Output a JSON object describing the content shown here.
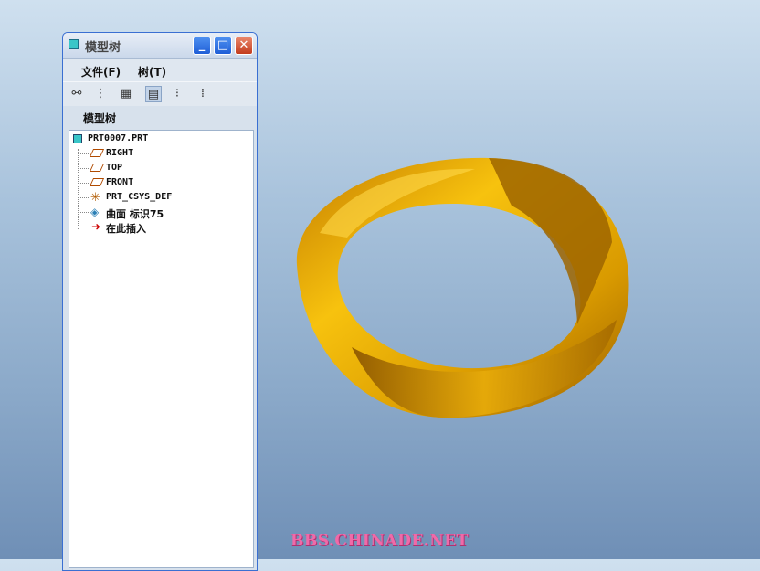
{
  "window": {
    "title": "模型树",
    "minimize": "_",
    "maximize": "□",
    "close": "✕"
  },
  "menu": {
    "file": "文件(F)",
    "tree": "树(T)"
  },
  "panel": {
    "label": "模型树"
  },
  "tree": {
    "root": "PRT0007.PRT",
    "items": [
      {
        "label": "RIGHT",
        "icon": "datum-plane-icon"
      },
      {
        "label": "TOP",
        "icon": "datum-plane-icon"
      },
      {
        "label": "FRONT",
        "icon": "datum-plane-icon"
      },
      {
        "label": "PRT_CSYS_DEF",
        "icon": "coordinate-system-icon"
      },
      {
        "label": "曲面 标识75",
        "icon": "surface-icon"
      },
      {
        "label": "在此插入",
        "icon": "insert-here-arrow-icon"
      }
    ]
  },
  "colors": {
    "background_top": "#cfe0ef",
    "background_bottom": "#6f8fb6",
    "model_gold": "#e0a000",
    "watermark": "#f06aa8"
  },
  "watermark": "BBS.CHINADE.NET"
}
